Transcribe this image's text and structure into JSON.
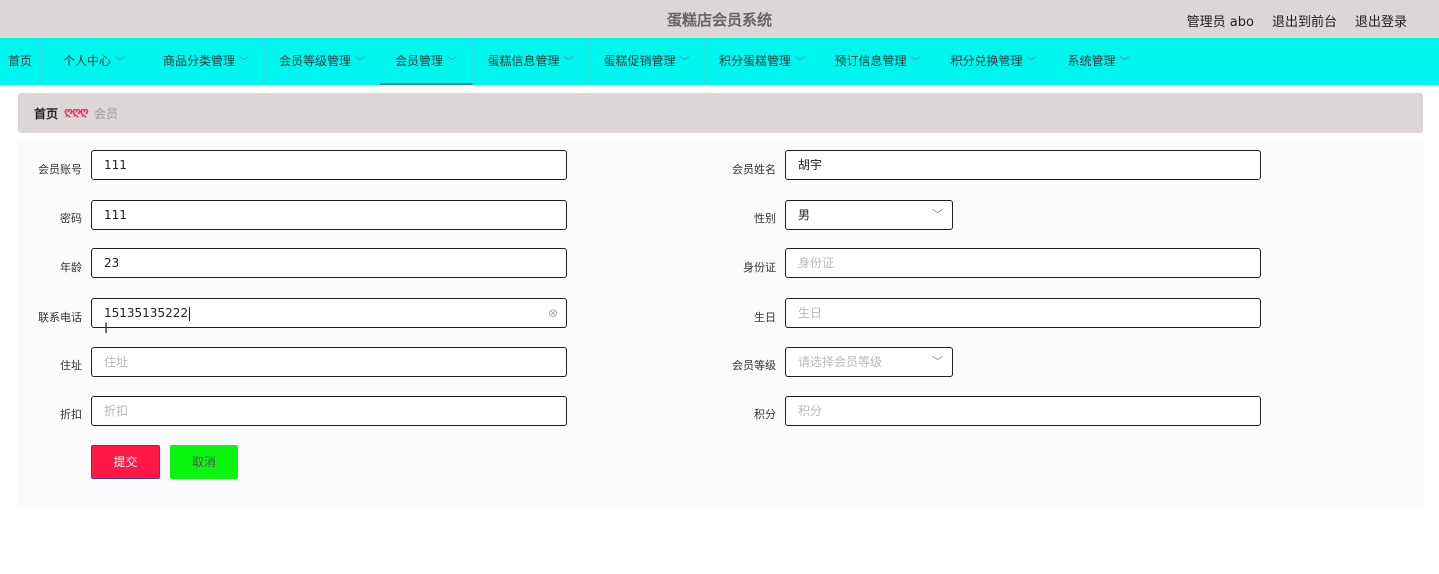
{
  "header": {
    "title": "蛋糕店会员系统",
    "admin_label": "管理员 abo",
    "exit_front": "退出到前台",
    "logout": "退出登录"
  },
  "nav": {
    "items": [
      {
        "label": "首页",
        "has_menu": false
      },
      {
        "label": "个人中心",
        "has_menu": true
      },
      {
        "label": "商品分类管理",
        "has_menu": true
      },
      {
        "label": "会员等级管理",
        "has_menu": true
      },
      {
        "label": "会员管理",
        "has_menu": true,
        "active": true
      },
      {
        "label": "蛋糕信息管理",
        "has_menu": true
      },
      {
        "label": "蛋糕促销管理",
        "has_menu": true
      },
      {
        "label": "积分蛋糕管理",
        "has_menu": true
      },
      {
        "label": "预订信息管理",
        "has_menu": true
      },
      {
        "label": "积分兑换管理",
        "has_menu": true
      },
      {
        "label": "系统管理",
        "has_menu": true
      }
    ]
  },
  "breadcrumb": {
    "home": "首页",
    "separator": "ღღღ",
    "current": "会员"
  },
  "form": {
    "account": {
      "label": "会员账号",
      "value": "111",
      "placeholder": ""
    },
    "name": {
      "label": "会员姓名",
      "value": "胡宇",
      "placeholder": ""
    },
    "password": {
      "label": "密码",
      "value": "111",
      "placeholder": ""
    },
    "gender": {
      "label": "性别",
      "value": "男"
    },
    "age": {
      "label": "年龄",
      "value": "23",
      "placeholder": ""
    },
    "id_card": {
      "label": "身份证",
      "value": "",
      "placeholder": "身份证"
    },
    "phone": {
      "label": "联系电话",
      "value": "15135135222",
      "placeholder": ""
    },
    "birthday": {
      "label": "生日",
      "value": "",
      "placeholder": "生日"
    },
    "address": {
      "label": "住址",
      "value": "",
      "placeholder": "住址"
    },
    "level": {
      "label": "会员等级",
      "value": "",
      "placeholder": "请选择会员等级"
    },
    "discount": {
      "label": "折扣",
      "value": "",
      "placeholder": "折扣"
    },
    "points": {
      "label": "积分",
      "value": "",
      "placeholder": "积分"
    }
  },
  "buttons": {
    "submit": "提交",
    "cancel": "取消"
  },
  "colors": {
    "nav_bg": "#00f5ee",
    "header_bg": "#ddd6d6",
    "submit_bg": "#ff1846",
    "cancel_bg": "#0bf50e"
  }
}
